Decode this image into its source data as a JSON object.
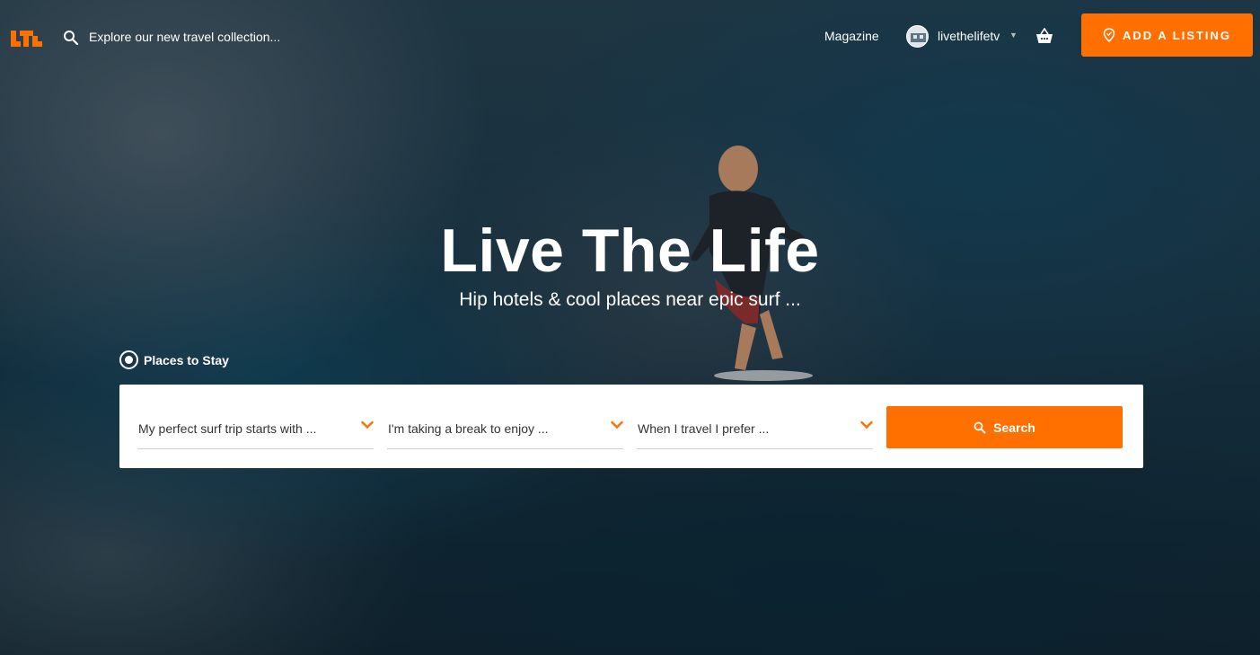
{
  "colors": {
    "accent": "#ff7000",
    "panel": "#ffffff",
    "text_dark": "#333333"
  },
  "nav": {
    "logo_icon": "ltl-logo",
    "search_icon": "search-icon",
    "search_placeholder": "Explore our new travel collection...",
    "magazine_label": "Magazine",
    "username": "livethelifetv",
    "basket_icon": "basket-icon",
    "add_listing_label": "ADD A LISTING",
    "add_listing_icon": "map-pin-icon"
  },
  "hero": {
    "title": "Live The Life",
    "subtitle": "Hip hotels & cool places near epic surf ..."
  },
  "search": {
    "mode_label": "Places to Stay",
    "selects": [
      {
        "placeholder": "My perfect surf trip starts with ..."
      },
      {
        "placeholder": "I'm taking a break to enjoy ..."
      },
      {
        "placeholder": "When I travel I prefer ..."
      }
    ],
    "button_label": "Search"
  }
}
